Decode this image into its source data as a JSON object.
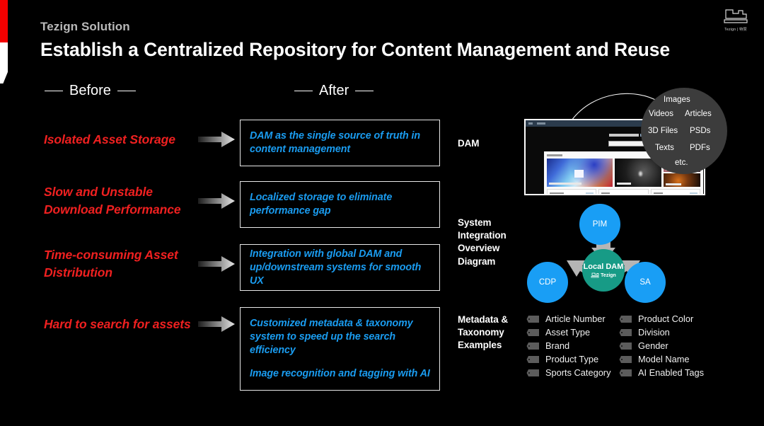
{
  "header": {
    "eyebrow": "Tezign Solution",
    "title": "Establish a Centralized Repository for Content Management and Reuse",
    "logo_text": "Tezign | 特赞"
  },
  "columns": {
    "before_label": "Before",
    "after_label": "After"
  },
  "before_items": [
    {
      "text": "Isolated Asset Storage"
    },
    {
      "text": "Slow and Unstable Download Performance"
    },
    {
      "text": "Time-consuming Asset Distribution"
    },
    {
      "text": "Hard to search for assets"
    }
  ],
  "after_items": [
    {
      "lines": [
        "DAM as the single source of truth in content management"
      ]
    },
    {
      "lines": [
        "Localized storage to eliminate performance gap"
      ]
    },
    {
      "lines": [
        "Integration with global DAM and up/downstream systems for smooth UX"
      ]
    },
    {
      "lines": [
        "Customized metadata & taxonomy system to speed up the search efficiency",
        "Image recognition and tagging with AI"
      ]
    }
  ],
  "right_sections": {
    "dam_label": "DAM",
    "system_label": "System Integration Overview Diagram",
    "metadata_label": "Metadata & Taxonomy Examples"
  },
  "asset_bubble": {
    "images": "Images",
    "videos": "Videos",
    "articles": "Articles",
    "files_3d": "3D Files",
    "psds": "PSDs",
    "texts": "Texts",
    "pdfs": "PDFs",
    "etc": "etc."
  },
  "diagram": {
    "pim": "PIM",
    "cdp": "CDP",
    "sa": "SA",
    "center": "Local DAM",
    "center_logo_text": "Tezign"
  },
  "metadata_examples": [
    "Article Number",
    "Product Color",
    "Asset Type",
    "Division",
    "Brand",
    "Gender",
    "Product Type",
    "Model Name",
    "Sports Category",
    "AI Enabled Tags"
  ],
  "colors": {
    "accent_red": "#ef2020",
    "accent_blue": "#1a9cf0",
    "node_blue": "#199ef5",
    "node_teal": "#179b86",
    "bubble_gray": "#3c3c3c",
    "edge_red": "#f40000",
    "background": "#000000"
  }
}
